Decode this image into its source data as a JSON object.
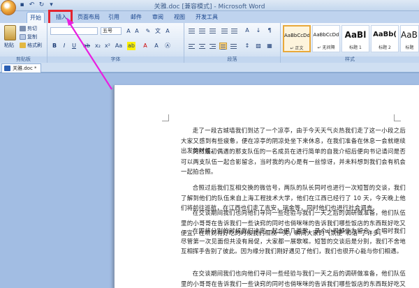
{
  "window": {
    "title": "关雅.doc [兼容模式] - Microsoft Word"
  },
  "quick_access": [
    "save-icon",
    "undo-icon",
    "redo-icon",
    "dropdown-icon"
  ],
  "tabs": [
    {
      "label": "开始"
    },
    {
      "label": "插入"
    },
    {
      "label": "页面布局"
    },
    {
      "label": "引用"
    },
    {
      "label": "邮件"
    },
    {
      "label": "审阅"
    },
    {
      "label": "视图"
    },
    {
      "label": "开发工具"
    }
  ],
  "clipboard": {
    "paste": "粘贴",
    "cut": "剪切",
    "copy": "复制",
    "painter": "格式刷",
    "label": "剪贴板"
  },
  "font": {
    "size": "五号",
    "label": "字体"
  },
  "paragraph": {
    "label": "段落"
  },
  "styles": {
    "label": "样式",
    "items": [
      {
        "sample": "AaBbCcDd",
        "name": "↵ 正文"
      },
      {
        "sample": "AaBbCcDd",
        "name": "↵ 无间隔"
      },
      {
        "sample": "AaBl",
        "name": "标题 1"
      },
      {
        "sample": "AaBb(",
        "name": "标题 2"
      },
      {
        "sample": "AaBI",
        "name": "标题"
      }
    ]
  },
  "doc_tab": {
    "label": "关雅.doc *"
  },
  "document": {
    "paragraphs": [
      "走了一段古城墙我们到达了一个凉亭，由于今天天气炎热我们走了这一小段之后大家又感到有些疲惫，便在凉亭的阴凉处坐下来休息，在我们准备在休息一会就继续出发的时候。",
      "突然最初偶遇的那支队伍的一名成员在进行简单的自我介绍后便向书记请问是否可以两支队伍一起合影留念，当时我的内心是有一丝惊讶，并未料想到我们会有机会一起拍合照。",
      "合照过后我们互相交换的微信号，两队的队长同时也进行一次短暂的交谈，我们了解到他们的队伍来自上海工程技术大学，他们在江西已经行了 10 天，今天晚上他们将前往巡航，在江西也们走了吉安，瑞金等，同时他们也进行社会调查。",
      "在交谈期间我们也向他们寻问一些经验与我们一天之后的调研做准备，他们队伍里的小哥哥在告诉我们一些诀窍的同时也俏咪咪的告诉我们哪些饭店的东西既好吃又便宜，在听到有好吃的时候我们相视一笑，瞬间大家的气氛便“和谐”了许多。",
      "在即将分别的时候我们决定一起合唱几首歌，录个小视频作为留念，合唱时我们尽管第一次见面但共没有局促，大家都一展歌喉。短暂的交谈后是分别，我们不舍地互相挥手告别了彼此。因为缘分我们刚好遇见了他们，我们也很开心能与你们相遇。",
      "在交谈期间我们也向他们寻问一些经验与我们一天之后的调研做准备，他们队伍里的小哥哥在告诉我们一些诀窍的同时也俏咪咪的告诉我们哪些饭店的东西既好吃又便宜，在听到有好吃的时候我们相视一笑，瞬间大家的气氛便“和谐”了许多。"
    ]
  },
  "colors": {
    "highlight": "#e3232f",
    "arrow": "#e91ee0"
  }
}
